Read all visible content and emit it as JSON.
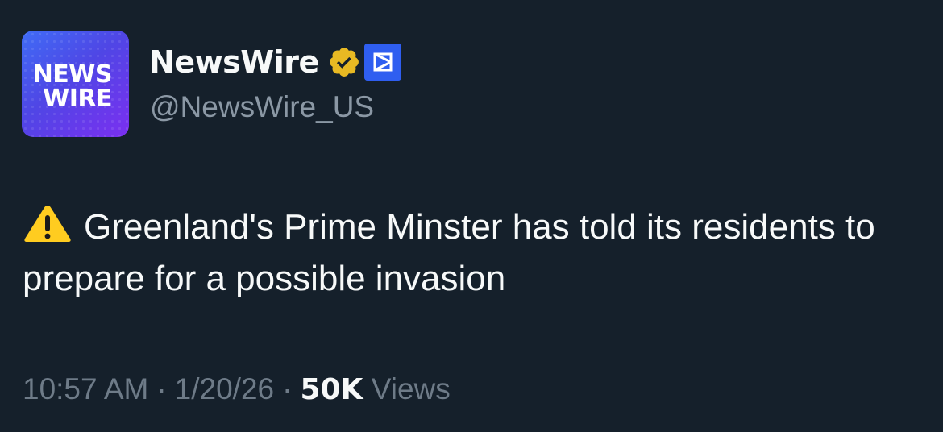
{
  "author": {
    "avatar_line1": "NEWS",
    "avatar_line2": "WIRE",
    "display_name": "NewsWire",
    "handle": "@NewsWire_US",
    "verified_icon": "verified-badge-gold",
    "affiliate_icon": "affiliate-badge-blue"
  },
  "tweet": {
    "emoji": "warning-icon",
    "text": "Greenland's Prime Minster has told its residents to prepare for a possible invasion"
  },
  "meta": {
    "time": "10:57 AM",
    "date": "1/20/26",
    "separator": "·",
    "views_count": "50K",
    "views_label": "Views"
  },
  "colors": {
    "background": "#15202b",
    "text_primary": "#f7f9f9",
    "text_secondary": "#8b98a5",
    "gold_badge": "#e8b923",
    "affiliate_badge": "#1d4ed8"
  }
}
